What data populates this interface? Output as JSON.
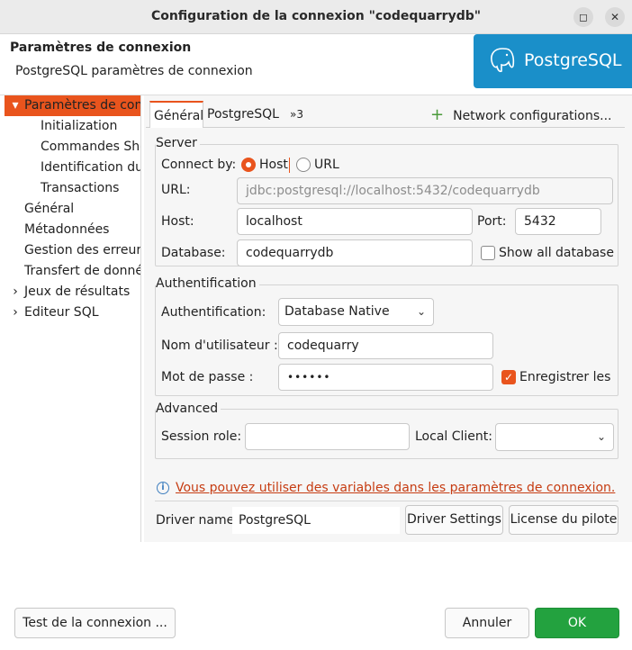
{
  "window": {
    "title": "Configuration de la connexion \"codequarrydb\"",
    "minimize_icon": "minimize-icon",
    "close_icon": "close-icon"
  },
  "header": {
    "title": "Paramètres de connexion",
    "subtitle": "PostgreSQL paramètres de connexion",
    "logo_text": "PostgreSQL"
  },
  "nav": {
    "items": [
      {
        "label": "Paramètres de conn",
        "expander": "▾",
        "selected": true
      },
      {
        "label": "Initialization"
      },
      {
        "label": "Commandes She"
      },
      {
        "label": "Identification du"
      },
      {
        "label": "Transactions"
      },
      {
        "label": "Général"
      },
      {
        "label": "Métadonnées"
      },
      {
        "label": "Gestion des erreurs"
      },
      {
        "label": "Transfert de donné"
      },
      {
        "label": "Jeux de résultats",
        "expander": "›"
      },
      {
        "label": "Editeur SQL",
        "expander": "›"
      }
    ]
  },
  "tabs": {
    "items": [
      {
        "label": "Général",
        "active": true
      },
      {
        "label": "PostgreSQL"
      },
      {
        "label": "»3"
      }
    ],
    "network_config": "Network configurations..."
  },
  "server": {
    "group_title": "Server",
    "connect_by_label": "Connect by:",
    "host_option": "Host",
    "url_option": "URL",
    "url_label": "URL:",
    "url_value": "jdbc:postgresql://localhost:5432/codequarrydb",
    "host_label": "Host:",
    "host_value": "localhost",
    "port_label": "Port:",
    "port_value": "5432",
    "database_label": "Database:",
    "database_value": "codequarrydb",
    "show_all_label": "Show all databases"
  },
  "auth": {
    "group_title": "Authentification",
    "auth_label": "Authentification:",
    "auth_value": "Database Native",
    "user_label": "Nom d'utilisateur :",
    "user_value": "codequarry",
    "password_label": "Mot de passe :",
    "password_value": "••••••",
    "save_label": "Enregistrer les m"
  },
  "advanced": {
    "group_title": "Advanced",
    "session_role_label": "Session role:",
    "session_role_value": "",
    "local_client_label": "Local Client:",
    "local_client_value": ""
  },
  "info": {
    "link_text": "Vous pouvez utiliser des variables dans les paramètres de connexion."
  },
  "driver": {
    "label": "Driver name:",
    "value": "PostgreSQL",
    "settings_button": "Driver Settings",
    "license_button": "License du pilote"
  },
  "footer": {
    "test_button": "Test de la connexion ...",
    "cancel_button": "Annuler",
    "ok_button": "OK"
  },
  "colors": {
    "accent": "#e9541d",
    "ok_green": "#23a23f",
    "postgres_blue": "#1a8fc9"
  }
}
